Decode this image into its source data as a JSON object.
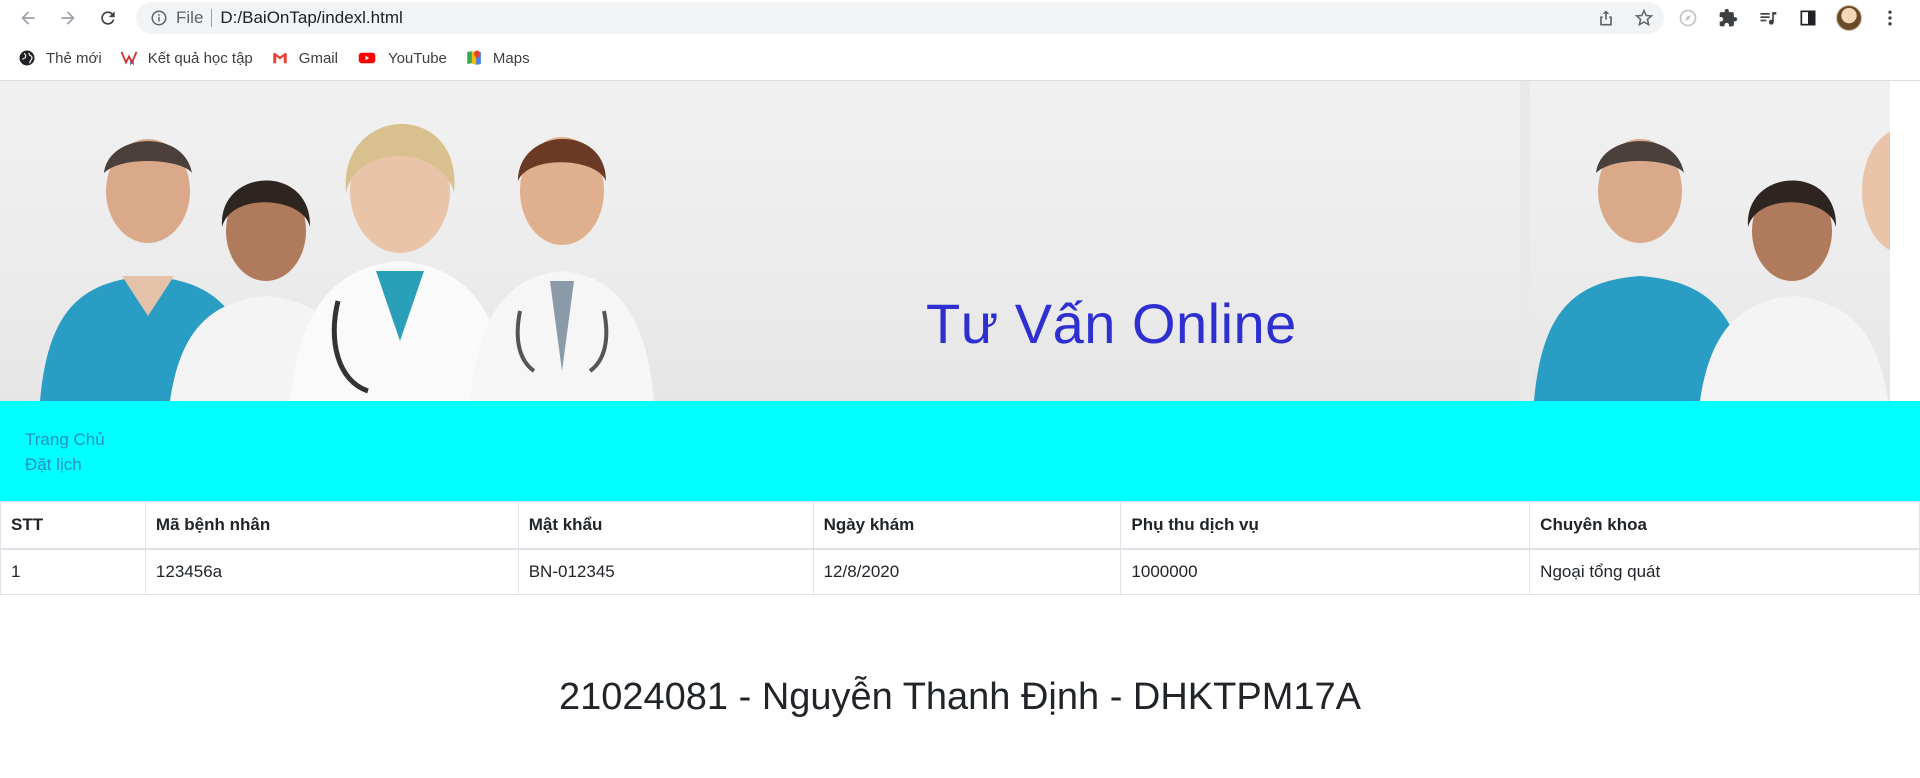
{
  "browser": {
    "omnibox": {
      "scheme_label": "File",
      "url": "D:/BaiOnTap/indexl.html"
    },
    "bookmarks": [
      {
        "label": "Thẻ mới",
        "icon": "globe-icon"
      },
      {
        "label": "Kết quả học tập",
        "icon": "school-logo-icon"
      },
      {
        "label": "Gmail",
        "icon": "gmail-icon"
      },
      {
        "label": "YouTube",
        "icon": "youtube-icon"
      },
      {
        "label": "Maps",
        "icon": "maps-icon"
      }
    ]
  },
  "banner": {
    "title": "Tư Vấn Online"
  },
  "nav": {
    "links": [
      "Trang Chủ",
      "Đặt lịch"
    ]
  },
  "table": {
    "headers": [
      "STT",
      "Mã bệnh nhân",
      "Mật khẩu",
      "Ngày khám",
      "Phụ thu dịch vụ",
      "Chuyên khoa"
    ],
    "rows": [
      [
        "1",
        "123456a",
        "BN-012345",
        "12/8/2020",
        "1000000",
        "Ngoại tổng quát"
      ]
    ]
  },
  "footer": {
    "text": "21024081 - Nguyễn Thanh Định - DHKTPM17A"
  },
  "colors": {
    "nav_bg": "#00ffff",
    "nav_link": "#2b8fc5",
    "banner_title": "#2d2fd0"
  }
}
